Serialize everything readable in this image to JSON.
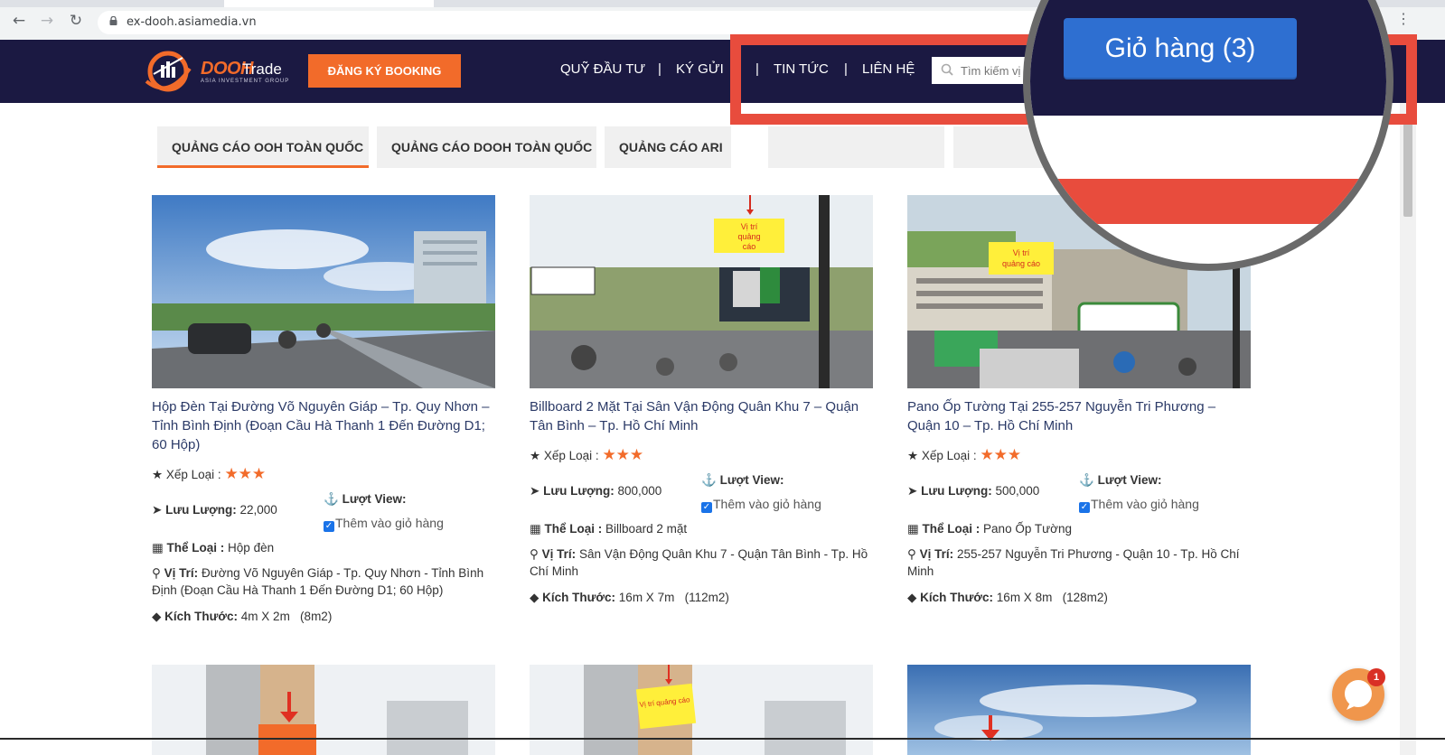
{
  "browser": {
    "url": "ex-dooh.asiamedia.vn"
  },
  "header": {
    "logo_main": "DOOH",
    "logo_trade": "Trade",
    "logo_sub": "ASIA INVESTMENT GROUP",
    "booking_button": "ĐĂNG KÝ BOOKING",
    "nav": {
      "fund": "QUỸ ĐẦU TƯ",
      "deposit": "KÝ GỬI",
      "news": "TIN TỨC",
      "contact": "LIÊN HỆ"
    },
    "separator": "|",
    "search_placeholder": "Tìm kiếm vị",
    "cart_button": "Giỏ hàng (3)"
  },
  "tabs": [
    {
      "label": "QUẢNG CÁO OOH TOÀN QUỐC",
      "active": true
    },
    {
      "label": "QUẢNG CÁO DOOH TOÀN QUỐC",
      "active": false
    },
    {
      "label": "QUẢNG CÁO ARI",
      "active": false
    }
  ],
  "labels": {
    "rating": "Xếp Loại :",
    "views": "Lượt View:",
    "traffic": "Lưu Lượng:",
    "type": "Thể Loại :",
    "location": "Vị Trí:",
    "size": "Kích Thước:",
    "add_to_cart": "Thêm vào giỏ hàng"
  },
  "products": [
    {
      "title": "Hộp Đèn Tại Đường Võ Nguyên Giáp – Tp. Quy Nhơn – Tỉnh Bình Định (Đoạn Cầu Hà Thanh 1 Đến Đường D1; 60 Hộp)",
      "rating_stars": 3,
      "traffic": "22,000",
      "type": "Hộp đèn",
      "location": "Đường Võ Nguyên Giáp - Tp. Quy Nhơn - Tỉnh Bình Định (Đoạn Cầu Hà Thanh 1 Đến Đường D1; 60 Hộp)",
      "size": "4m X 2m   (8m2)"
    },
    {
      "title": "Billboard 2 Mặt Tại Sân Vận Động Quân Khu 7 – Quận Tân Bình – Tp. Hồ Chí Minh",
      "rating_stars": 3,
      "traffic": "800,000",
      "type": "Billboard 2 mặt",
      "location": "Sân Vận Động Quân Khu 7 - Quận Tân Bình - Tp. Hồ Chí Minh",
      "size": "16m X 7m   (112m2)",
      "photo_sign": "Vị trí quảng cáo"
    },
    {
      "title": "Pano Ốp Tường Tại 255-257 Nguyễn Tri Phương – Quận 10 – Tp. Hồ Chí Minh",
      "rating_stars": 3,
      "traffic": "500,000",
      "type": "Pano Ốp Tường",
      "location": "255-257 Nguyễn Tri Phương - Quận 10 - Tp. Hồ Chí Minh",
      "size": "16m X 8m   (128m2)",
      "photo_sign": "Vị trí quảng cáo"
    }
  ],
  "bottom_photo_sign": "Vị trí quảng cáo",
  "chat": {
    "badge": "1"
  },
  "colors": {
    "header_bg": "#1b1942",
    "accent": "#f26b2a",
    "cart_blue": "#2e6fd1",
    "annotation_red": "#e84c3d",
    "title_blue": "#2b3a67"
  }
}
